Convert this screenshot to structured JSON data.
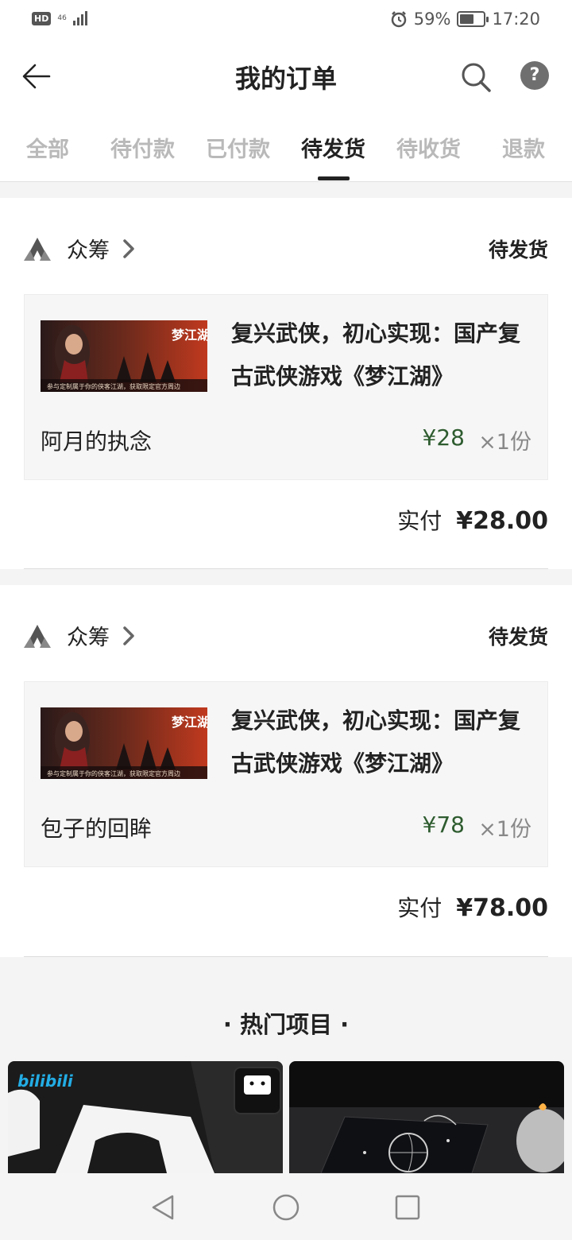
{
  "status_bar": {
    "hd": "HD",
    "network": "46",
    "battery_percent": "59%",
    "battery_level": 0.59,
    "time": "17:20",
    "icons": [
      "hd-icon",
      "signal-icon",
      "alarm-icon",
      "battery-icon"
    ]
  },
  "header": {
    "title": "我的订单",
    "back_icon": "arrow-left-icon",
    "search_icon": "search-icon",
    "help_icon": "help-icon",
    "help_glyph": "?"
  },
  "tabs": [
    {
      "label": "全部",
      "active": false
    },
    {
      "label": "待付款",
      "active": false
    },
    {
      "label": "已付款",
      "active": false
    },
    {
      "label": "待发货",
      "active": true
    },
    {
      "label": "待收货",
      "active": false
    },
    {
      "label": "退款",
      "active": false
    }
  ],
  "orders": [
    {
      "shop_name": "众筹",
      "status": "待发货",
      "product_name": "复兴武侠，初心实现：国产复古武侠游戏《梦江湖》",
      "thumb_title": "梦江湖",
      "thumb_caption": "参与定制属于你的侠客江湖，获取限定官方周边",
      "reward_name": "阿月的执念",
      "price": "¥28",
      "quantity": "×1份",
      "total_label": "实付",
      "total_amount": "¥28.00"
    },
    {
      "shop_name": "众筹",
      "status": "待发货",
      "product_name": "复兴武侠，初心实现：国产复古武侠游戏《梦江湖》",
      "thumb_title": "梦江湖",
      "thumb_caption": "参与定制属于你的侠客江湖，获取限定官方周边",
      "reward_name": "包子的回眸",
      "price": "¥78",
      "quantity": "×1份",
      "total_label": "实付",
      "total_amount": "¥78.00"
    }
  ],
  "hot_section": {
    "title": "· 热门项目 ·",
    "cards": [
      {
        "logo": "bilibili"
      },
      {
        "logo": ""
      }
    ]
  },
  "nav_bar": {
    "icons": [
      "nav-back-icon",
      "nav-home-icon",
      "nav-recents-icon"
    ]
  },
  "colors": {
    "price_green": "#2e5c2f",
    "inactive_tab": "#b9b9b9",
    "text": "#222222"
  }
}
